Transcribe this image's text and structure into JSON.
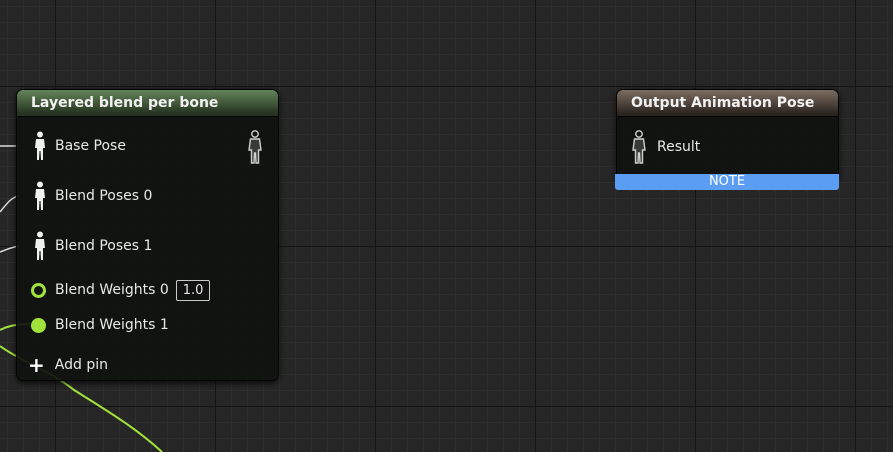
{
  "colors": {
    "graph_background": "#262626",
    "pose_wire": "#dcdcdc",
    "float_wire": "#a2e33b",
    "layered_header": "#4e6b46",
    "output_header": "#6e5f55",
    "note_bar": "#5a9df2"
  },
  "layered_node": {
    "title": "Layered blend per bone",
    "pins": [
      {
        "label": "Base Pose",
        "icon": "pose-icon"
      },
      {
        "label": "Blend Poses 0",
        "icon": "pose-icon"
      },
      {
        "label": "Blend Poses 1",
        "icon": "pose-icon"
      },
      {
        "label": "Blend Weights 0",
        "icon": "float-pin-icon",
        "value": "1.0"
      },
      {
        "label": "Blend Weights 1",
        "icon": "float-pin-icon"
      }
    ],
    "add_pin_label": "Add pin",
    "output_icon": "pose-output-icon"
  },
  "output_node": {
    "title": "Output Animation Pose",
    "pins": [
      {
        "label": "Result",
        "icon": "pose-output-icon"
      }
    ],
    "note_label": "NOTE"
  }
}
